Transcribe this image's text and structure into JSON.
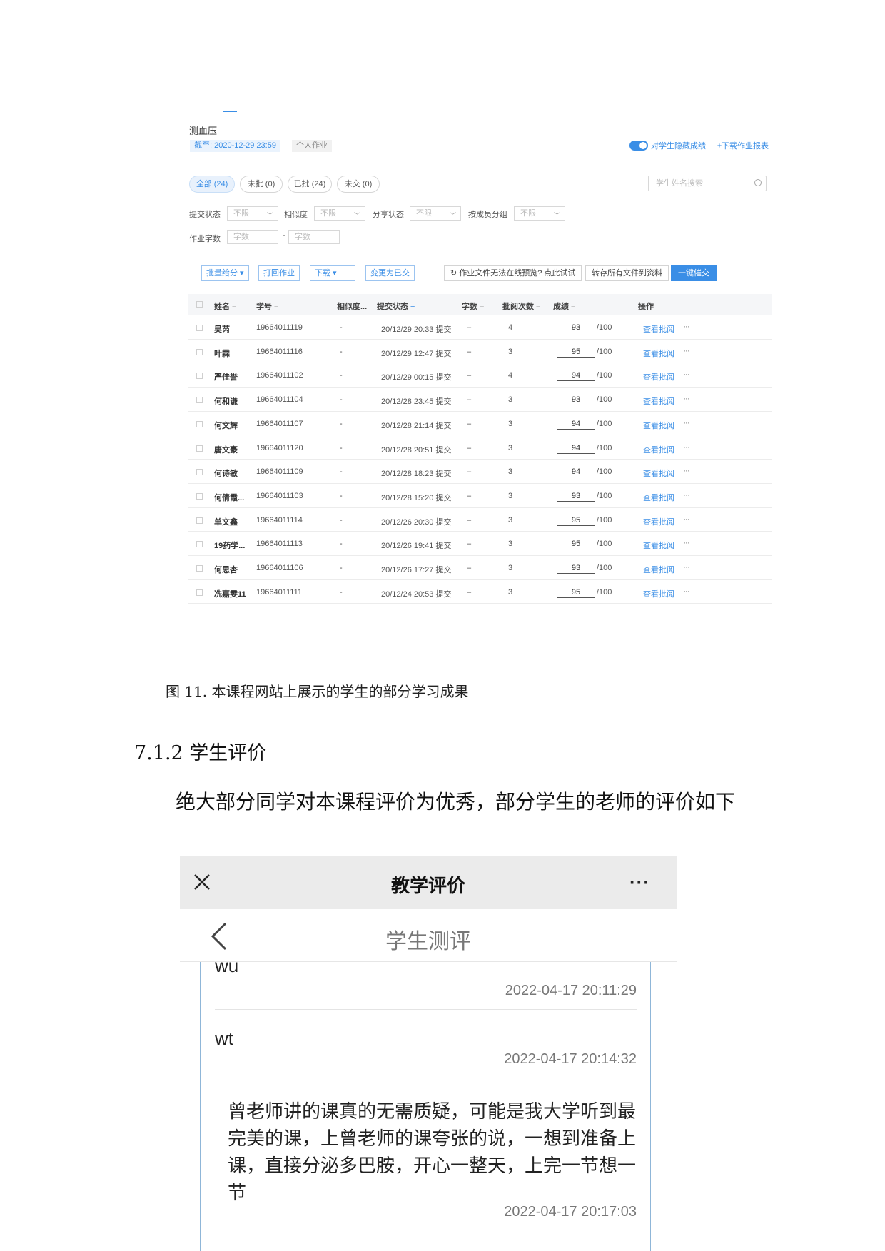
{
  "lms": {
    "hw_title": "测血压",
    "deadline": "截至: 2020-12-29 23:59",
    "hw_type": "个人作业",
    "hide_scores_label": "对学生隐藏成绩",
    "download_report": "±下载作业报表",
    "hide_scores_enabled": true,
    "accent_color": "#3a8ee6",
    "tabs": [
      "全部 (24)",
      "未批 (0)",
      "已批 (24)",
      "未交 (0)"
    ],
    "active_tab": 0,
    "search_placeholder": "学生姓名搜索",
    "filters": {
      "submit_status_label": "提交状态",
      "submit_status_value": "不限",
      "similarity_label": "相似度",
      "similarity_value": "不限",
      "share_status_label": "分享状态",
      "share_status_value": "不限",
      "group_label": "按成员分组",
      "group_value": "不限",
      "word_count_label": "作业字数",
      "word_min_placeholder": "字数",
      "word_max_placeholder": "字数",
      "range_sep": "-"
    },
    "actions": {
      "batch_score": "批量给分 ▾",
      "print": "打回作业",
      "download": "下载 ▾",
      "mark_submitted": "变更为已交",
      "preview_hint": "作业文件无法在线预览? 点此试试",
      "save_all": "转存所有文件到资料",
      "urge_all": "一键催交"
    },
    "columns": {
      "name": "姓名",
      "id": "学号",
      "similarity": "相似度...",
      "status": "提交状态",
      "words": "字数",
      "reviews": "批阅次数",
      "score": "成绩",
      "ops": "操作"
    },
    "sort_symbol": "÷",
    "score_max": "/100",
    "review_label": "查看批阅",
    "more_label": "···",
    "rows": [
      {
        "name": "吴芮",
        "id": "19664011119",
        "sim": "-",
        "status": "20/12/29 20:33 提交",
        "words": "–",
        "reviews": "4",
        "score": "93"
      },
      {
        "name": "叶霖",
        "id": "19664011116",
        "sim": "-",
        "status": "20/12/29 12:47 提交",
        "words": "–",
        "reviews": "3",
        "score": "95"
      },
      {
        "name": "严佳誉",
        "id": "19664011102",
        "sim": "-",
        "status": "20/12/29 00:15 提交",
        "words": "–",
        "reviews": "4",
        "score": "94"
      },
      {
        "name": "何和谦",
        "id": "19664011104",
        "sim": "-",
        "status": "20/12/28 23:45 提交",
        "words": "–",
        "reviews": "3",
        "score": "93"
      },
      {
        "name": "何文辉",
        "id": "19664011107",
        "sim": "-",
        "status": "20/12/28 21:14 提交",
        "words": "–",
        "reviews": "3",
        "score": "94"
      },
      {
        "name": "唐文豪",
        "id": "19664011120",
        "sim": "-",
        "status": "20/12/28 20:51 提交",
        "words": "–",
        "reviews": "3",
        "score": "94"
      },
      {
        "name": "何诗敏",
        "id": "19664011109",
        "sim": "-",
        "status": "20/12/28 18:23 提交",
        "words": "–",
        "reviews": "3",
        "score": "94"
      },
      {
        "name": "何倩霞...",
        "id": "19664011103",
        "sim": "-",
        "status": "20/12/28 15:20 提交",
        "words": "–",
        "reviews": "3",
        "score": "93"
      },
      {
        "name": "单文鑫",
        "id": "19664011114",
        "sim": "-",
        "status": "20/12/26 20:30 提交",
        "words": "–",
        "reviews": "3",
        "score": "95"
      },
      {
        "name": "19药学...",
        "id": "19664011113",
        "sim": "-",
        "status": "20/12/26 19:41 提交",
        "words": "–",
        "reviews": "3",
        "score": "95"
      },
      {
        "name": "何思杏",
        "id": "19664011106",
        "sim": "-",
        "status": "20/12/26 17:27 提交",
        "words": "–",
        "reviews": "3",
        "score": "93"
      },
      {
        "name": "冼嘉雯11",
        "id": "19664011111",
        "sim": "-",
        "status": "20/12/24 20:53 提交",
        "words": "–",
        "reviews": "3",
        "score": "95"
      }
    ]
  },
  "doc": {
    "caption": "图 11. 本课程网站上展示的学生的部分学习成果",
    "section_heading": "7.1.2 学生评价",
    "body": "绝大部分同学对本课程评价为优秀，部分学生的老师的评价如下"
  },
  "mobile": {
    "title": "教学评价",
    "subtitle": "学生测评",
    "menu": "···",
    "comments": [
      {
        "text": "wu",
        "time": "2022-04-17 20:11:29"
      },
      {
        "text": "wt",
        "time": "2022-04-17 20:14:32"
      },
      {
        "text": "曾老师讲的课真的无需质疑，可能是我大学听到最完美的课，上曾老师的课夸张的说，一想到准备上课，直接分泌多巴胺，开心一整天，上完一节想一节",
        "time": "2022-04-17 20:17:03"
      }
    ]
  }
}
